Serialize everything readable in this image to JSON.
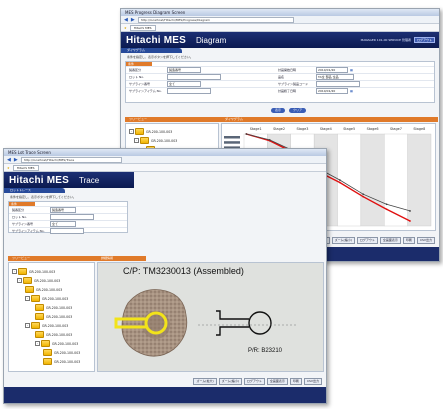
{
  "diagram": {
    "window_title": "MES   Progress Diagram Screen",
    "address_url": "http://localhost/Hitachi/MES/Progress/Diagram",
    "tab_label": "Hitachi MES",
    "brand": "Hitachi MES",
    "screen": "Diagram",
    "user_text": "MANAGER 101-00 SERVICE 管理者",
    "logout": "ログアウト",
    "section": "ダイヤグラム",
    "hint": "条件を指定し、表示ボタンを押下してください。",
    "form_caption": "条件",
    "fields_left": [
      {
        "label": "製番区分",
        "value": "製造番号"
      },
      {
        "label": "ロット No.",
        "value": ""
      },
      {
        "label": "サブライン番号",
        "value": "全て"
      },
      {
        "label": "サブラインアイテム No.",
        "value": ""
      }
    ],
    "fields_right": [
      {
        "label": "計画開始日時",
        "value": "2010/01/20"
      },
      {
        "label": "品名",
        "value": "TA全 部品 全品"
      },
      {
        "label": "サブライン製品コード",
        "value": ""
      },
      {
        "label": "計画終了日時",
        "value": "2010/01/20"
      }
    ],
    "display_btn": "表示",
    "clear_btn": "クリア",
    "tree_header": "ツリービュー",
    "chart_header": "ダイヤグラム",
    "stages": [
      "Stage1",
      "Stage2",
      "Stage3",
      "Stage4",
      "Stage5",
      "Stage6",
      "Stage7",
      "Stage8"
    ],
    "footer_buttons": [
      "ズーム(拡大)",
      "ズーム(縮小)",
      "ログアウト",
      "全画面表示",
      "印刷",
      "CSV出力"
    ],
    "tree": [
      "GR-200-100-003",
      "GR-200-100-003",
      "GR-200-100-003",
      "GR-200-100-003",
      "GR-200-100-003",
      "GR-200-100-003",
      "GR-200-100-003",
      "GR-200-100-003",
      "GR-200-100-003",
      "GR-200-100-003"
    ]
  },
  "trace": {
    "window_title": "MES   Lot Trace Screen",
    "address_url": "http://localhost/Hitachi/MES/Trace",
    "tab_label": "Hitachi MES",
    "brand": "Hitachi MES",
    "screen": "Trace",
    "section": "ロットトレース",
    "hint": "条件を指定し、表示ボタンを押下してください。",
    "form_caption": "条件",
    "fields": [
      {
        "label": "製番区分",
        "value": "製造番号"
      },
      {
        "label": "ロット No.",
        "value": ""
      },
      {
        "label": "サブライン番号",
        "value": "全て"
      },
      {
        "label": "サブラインアイテム No.",
        "value": ""
      }
    ],
    "tree_header": "ツリービュー",
    "detail_header": "詳細情報",
    "tree": [
      "GR-200-100-003",
      "GR-200-100-003",
      "GR-200-100-003",
      "GR-200-100-003",
      "GR-200-100-003",
      "GR-200-100-003",
      "GR-200-100-003",
      "GR-200-100-003",
      "GR-200-100-003",
      "GR-200-100-003",
      "GR-200-100-003",
      "GR-200-100-003"
    ],
    "cp_label": "C/P: TM3230013 (Assembled)",
    "pr_label": "P/R: B23210",
    "footer_buttons": [
      "ズーム(拡大)",
      "ズーム(縮小)",
      "ログアウト",
      "全画面表示",
      "印刷",
      "CSV出力"
    ]
  },
  "chart_data": {
    "type": "line",
    "x": [
      "Stage1",
      "Stage2",
      "Stage3",
      "Stage4",
      "Stage5",
      "Stage6",
      "Stage7",
      "Stage8"
    ],
    "series": [
      {
        "color": "#e01010",
        "values": [
          0,
          8,
          22,
          44,
          58,
          75,
          90,
          104
        ]
      },
      {
        "color": "#444444",
        "values": [
          0,
          7,
          20,
          40,
          55,
          72,
          84,
          92
        ]
      }
    ]
  }
}
